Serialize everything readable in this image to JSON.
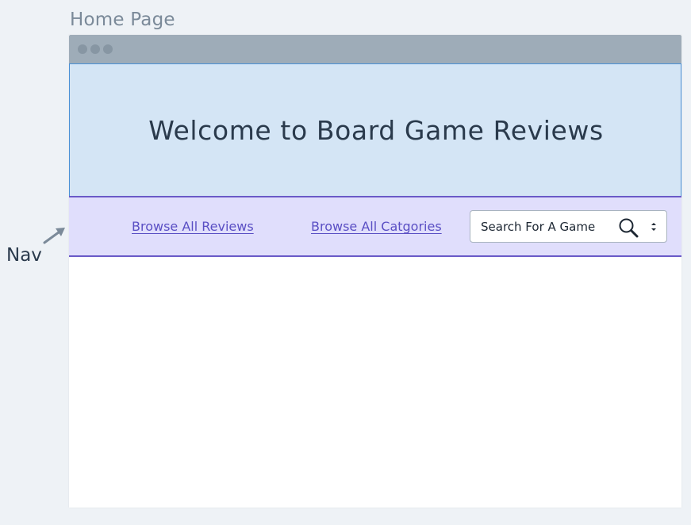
{
  "page_label": "Home Page",
  "hero": {
    "title": "Welcome to Board Game Reviews"
  },
  "nav": {
    "links": [
      {
        "label": "Browse All Reviews"
      },
      {
        "label": "Browse All Catgories"
      }
    ],
    "search": {
      "label": "Search For A Game",
      "icon": "search-icon",
      "stepper_icon": "stepper-icon"
    }
  },
  "annotation": {
    "label": "Nav",
    "icon": "arrow-icon"
  },
  "colors": {
    "background": "#eef2f6",
    "titlebar": "#9eacb8",
    "hero_bg": "#d4e5f5",
    "hero_border": "#4a90d6",
    "nav_bg": "#e0defc",
    "nav_border": "#6a5ac8",
    "link": "#5a4fc4",
    "title_text": "#2a3a4c"
  }
}
